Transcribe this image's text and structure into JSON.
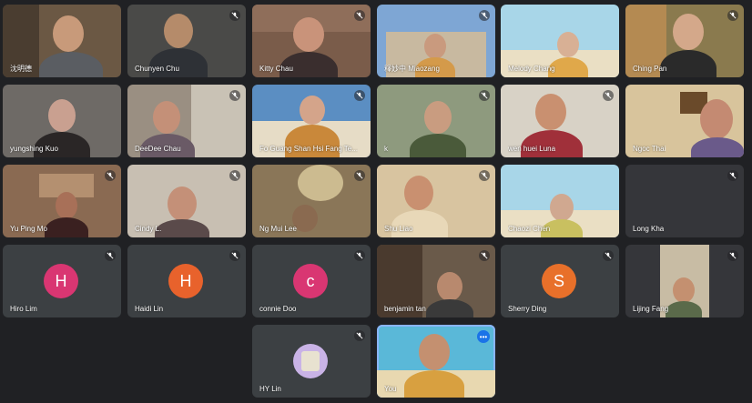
{
  "participants": [
    {
      "name": "沈明德",
      "type": "video"
    },
    {
      "name": "Chunyen Chu",
      "type": "video"
    },
    {
      "name": "Kitty Chau",
      "type": "video"
    },
    {
      "name": "釋妙中 Miaozang",
      "type": "video"
    },
    {
      "name": "Melody Chang",
      "type": "video"
    },
    {
      "name": "Ching Pan",
      "type": "video"
    },
    {
      "name": "yungshing Kuo",
      "type": "video"
    },
    {
      "name": "DeeDee Chau",
      "type": "video"
    },
    {
      "name": "Fo Guang Shan Hsi Fang Te...",
      "type": "video"
    },
    {
      "name": "k",
      "type": "video"
    },
    {
      "name": "wen huei Luna",
      "type": "video"
    },
    {
      "name": "Ngoc Thai",
      "type": "video"
    },
    {
      "name": "Yu Ping Mo",
      "type": "video"
    },
    {
      "name": "Cindy L.",
      "type": "video"
    },
    {
      "name": "Ng Mui Lee",
      "type": "video"
    },
    {
      "name": "Shu Liao",
      "type": "video"
    },
    {
      "name": "Chaozi Chen",
      "type": "video"
    },
    {
      "name": "Long Kha",
      "type": "blank"
    },
    {
      "name": "Hiro Lim",
      "type": "avatar",
      "initial": "H",
      "color": "#d93672"
    },
    {
      "name": "Haidi Lin",
      "type": "avatar",
      "initial": "H",
      "color": "#e8622c"
    },
    {
      "name": "connie Doo",
      "type": "avatar",
      "initial": "c",
      "color": "#d93672"
    },
    {
      "name": "benjamin tan",
      "type": "video"
    },
    {
      "name": "Sherry Ding",
      "type": "avatar",
      "initial": "S",
      "color": "#e8702a"
    },
    {
      "name": "Lijing Fang",
      "type": "video"
    },
    {
      "name": "HY Lin",
      "type": "avatar",
      "initial": "",
      "color": "#c9b3e6"
    },
    {
      "name": "You",
      "type": "video"
    }
  ],
  "accent_color": "#8ab4f8",
  "more_options_label": "•••"
}
